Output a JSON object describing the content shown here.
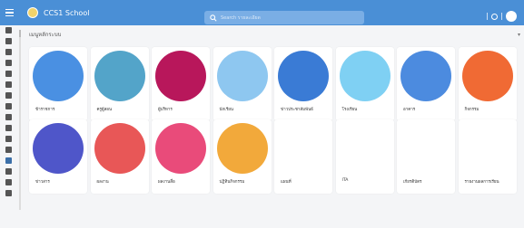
{
  "app": {
    "title": "CCS1 School",
    "menu_icon": "hamburger-icon",
    "logo_icon": "school-logo-icon"
  },
  "search": {
    "placeholder": "Search รายละเอียด",
    "icon": "search-icon"
  },
  "header_controls": {
    "icons": [
      "gear-icon",
      "user-avatar-icon"
    ]
  },
  "sidebar": {
    "items": [
      {
        "icon": "home-icon"
      },
      {
        "icon": "document-icon"
      },
      {
        "icon": "inbox-icon"
      },
      {
        "icon": "users-icon"
      },
      {
        "icon": "user-group-icon"
      },
      {
        "icon": "user-add-icon"
      },
      {
        "icon": "clipboard-icon"
      },
      {
        "icon": "list-icon"
      },
      {
        "icon": "folder-icon"
      },
      {
        "icon": "calendar-icon"
      },
      {
        "icon": "person-icon"
      },
      {
        "icon": "chart-icon"
      },
      {
        "icon": "home-active-icon",
        "active": true
      },
      {
        "icon": "graduation-icon"
      },
      {
        "icon": "bookmark-icon"
      },
      {
        "icon": "settings-icon"
      }
    ]
  },
  "page": {
    "title": "เมนูหลักระบบ",
    "filter_icon": "funnel-icon"
  },
  "colors": {
    "topbar": "#4a8fd6",
    "accent": "#3b6fa8"
  },
  "cards": [
    {
      "label": "ข้าราชการ",
      "icon": "teacher-portrait-icon",
      "bg": "#4a90e2"
    },
    {
      "label": "ครูผู้สอน",
      "icon": "teacher-classroom-icon",
      "bg": "#53a4c9"
    },
    {
      "label": "ผู้บริหาร",
      "icon": "graduate-student-icon",
      "bg": "#b8175b"
    },
    {
      "label": "นักเรียน",
      "icon": "student-group-icon",
      "bg": "#8ec7f0"
    },
    {
      "label": "ข่าวประชาสัมพันธ์",
      "icon": "newspaper-icon",
      "bg": "#3a7bd5"
    },
    {
      "label": "โรงเรียน",
      "icon": "school-building-icon",
      "bg": "#7fd0f3"
    },
    {
      "label": "อาคาร",
      "icon": "building-icon",
      "bg": "#4c8bdf"
    },
    {
      "label": "กิจกรรม",
      "icon": "approved-group-icon",
      "bg": "#f06a34"
    },
    {
      "label": "ข่าวสาร",
      "icon": "news-touch-icon",
      "bg": "#4f56c9"
    },
    {
      "label": "ผลงาน",
      "icon": "diamond-award-icon",
      "bg": "#e85757"
    },
    {
      "label": "ผลงานสื่อ",
      "icon": "multimedia-icon",
      "bg": "#e94b7a"
    },
    {
      "label": "ปฏิทินกิจกรรม",
      "icon": "calendar-clock-icon",
      "bg": "#f2a93b"
    },
    {
      "label": "แผนที่",
      "icon": "map-route-icon",
      "bg": "#ffffff"
    },
    {
      "label": "ITA",
      "icon": "ita-logo-icon",
      "bg": "#ffffff"
    },
    {
      "label": "เกียรติบัตร",
      "icon": "certificate-icon",
      "bg": "#ffffff"
    },
    {
      "label": "รายงานผลการเรียน",
      "icon": "report-search-icon",
      "bg": "#ffffff"
    }
  ]
}
